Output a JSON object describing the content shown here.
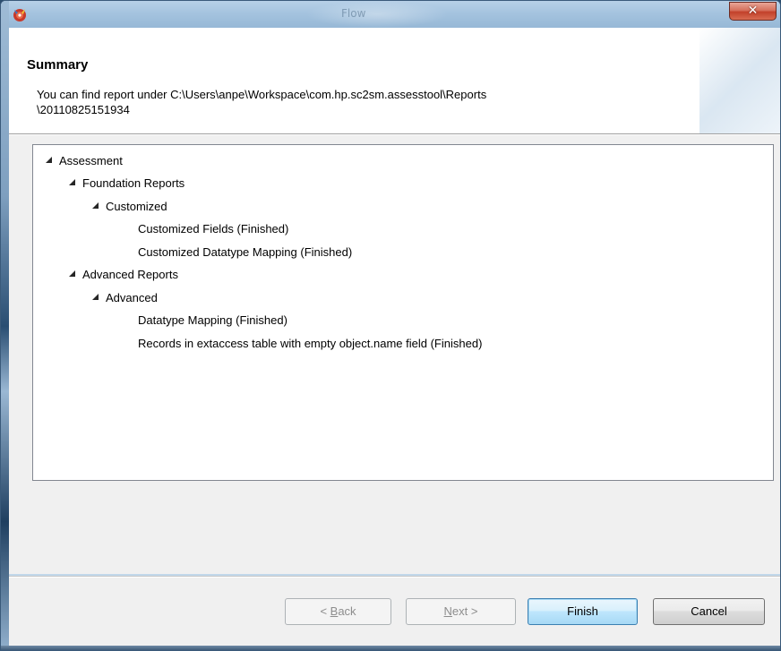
{
  "window": {
    "title": "Flow"
  },
  "header": {
    "title": "Summary",
    "description_line1": "You can find report under C:\\Users\\anpe\\Workspace\\com.hp.sc2sm.assesstool\\Reports",
    "description_line2": "\\20110825151934"
  },
  "tree": {
    "items": [
      {
        "label": "Assessment",
        "level": 0,
        "expanded": true
      },
      {
        "label": "Foundation Reports",
        "level": 1,
        "expanded": true
      },
      {
        "label": "Customized",
        "level": 2,
        "expanded": true
      },
      {
        "label": "Customized Fields (Finished)",
        "level": 3,
        "expanded": false
      },
      {
        "label": "Customized Datatype Mapping (Finished)",
        "level": 3,
        "expanded": false
      },
      {
        "label": "Advanced Reports",
        "level": 1,
        "expanded": true
      },
      {
        "label": "Advanced",
        "level": 2,
        "expanded": true
      },
      {
        "label": "Datatype Mapping (Finished)",
        "level": 3,
        "expanded": false
      },
      {
        "label": "Records in extaccess table with empty object.name field (Finished)",
        "level": 3,
        "expanded": false
      }
    ]
  },
  "buttons": {
    "back": {
      "prefix": "< ",
      "mnemonic": "B",
      "rest": "ack",
      "enabled": false
    },
    "next": {
      "mnemonic": "N",
      "rest": "ext >",
      "enabled": false
    },
    "finish": {
      "label": "Finish",
      "enabled": true,
      "default": true
    },
    "cancel": {
      "label": "Cancel",
      "enabled": true
    }
  },
  "icons": {
    "app": "app-logo-icon",
    "close": "close-icon",
    "tree_expanded": "tree-expanded-arrow-icon"
  },
  "colors": {
    "default_button_border": "#3c7fb1",
    "disabled_text": "#8d8d8d",
    "close_button": "#c2412a"
  }
}
